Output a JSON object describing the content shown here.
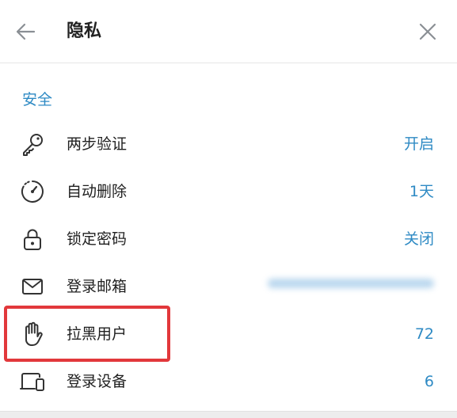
{
  "header": {
    "title": "隐私"
  },
  "security": {
    "section_title": "安全",
    "items": [
      {
        "label": "两步验证",
        "value": "开启",
        "icon": "key-icon"
      },
      {
        "label": "自动删除",
        "value": "1天",
        "icon": "timer-icon"
      },
      {
        "label": "锁定密码",
        "value": "关闭",
        "icon": "lock-icon"
      },
      {
        "label": "登录邮箱",
        "value": "",
        "icon": "mail-icon"
      },
      {
        "label": "拉黑用户",
        "value": "72",
        "icon": "hand-icon"
      },
      {
        "label": "登录设备",
        "value": "6",
        "icon": "devices-icon"
      }
    ]
  },
  "colors": {
    "accent": "#2e8ac4",
    "highlight": "#e2383b"
  }
}
